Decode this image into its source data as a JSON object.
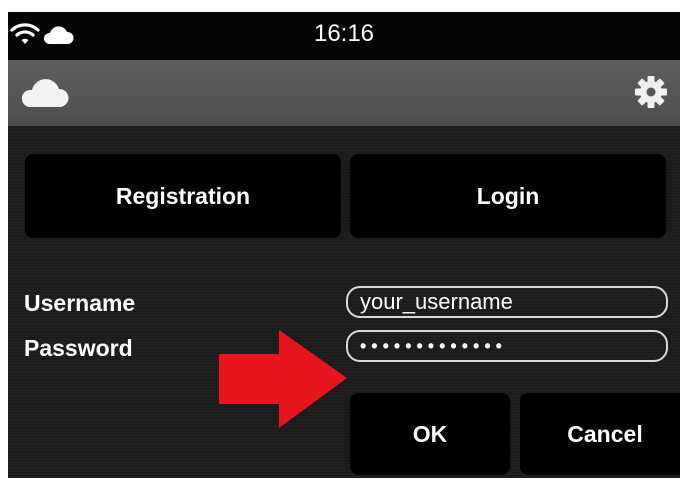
{
  "status_bar": {
    "time": "16:16",
    "icons": [
      "wifi-icon",
      "cloud-icon"
    ]
  },
  "app_bar": {
    "icons": [
      "cloud-icon",
      "gear-icon"
    ]
  },
  "tabs": {
    "registration_label": "Registration",
    "login_label": "Login"
  },
  "form": {
    "username_label": "Username",
    "username_value": "your_username",
    "password_label": "Password",
    "password_value": "•••••••••••••"
  },
  "annotation": {
    "arrow_color": "#e8141b"
  },
  "actions": {
    "ok_label": "OK",
    "cancel_label": "Cancel"
  }
}
